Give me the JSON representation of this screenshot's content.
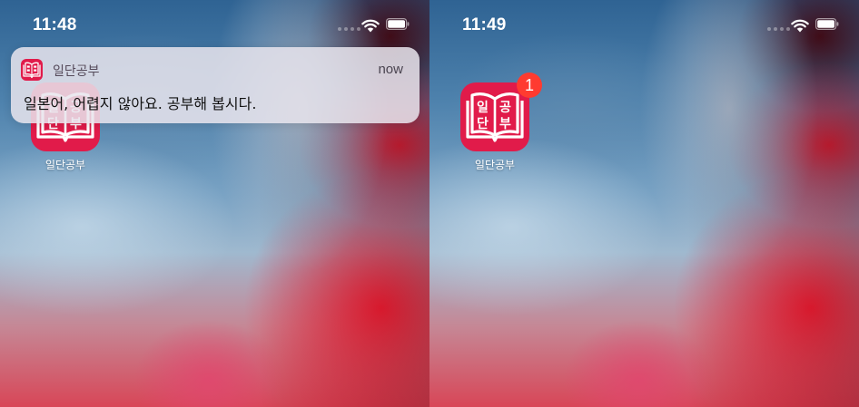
{
  "screens": [
    {
      "status_bar": {
        "time": "11:48"
      },
      "home": {
        "app": {
          "name": "일단공부",
          "icon_glyphs": [
            "일",
            "단",
            "공",
            "부"
          ]
        }
      },
      "notification": {
        "app_name": "일단공부",
        "time": "now",
        "message": "일본어, 어렵지 않아요. 공부해 봅시다."
      }
    },
    {
      "status_bar": {
        "time": "11:49"
      },
      "home": {
        "app": {
          "name": "일단공부",
          "icon_glyphs": [
            "일",
            "단",
            "공",
            "부"
          ],
          "badge_count": "1"
        }
      }
    }
  ],
  "colors": {
    "app_icon": "#e11b4a",
    "badge": "#ff3b30",
    "notification_bg": "#e8e4ec"
  },
  "icons": {
    "status": [
      "signal-icon",
      "wifi-icon",
      "battery-icon"
    ],
    "app": "book-icon"
  }
}
